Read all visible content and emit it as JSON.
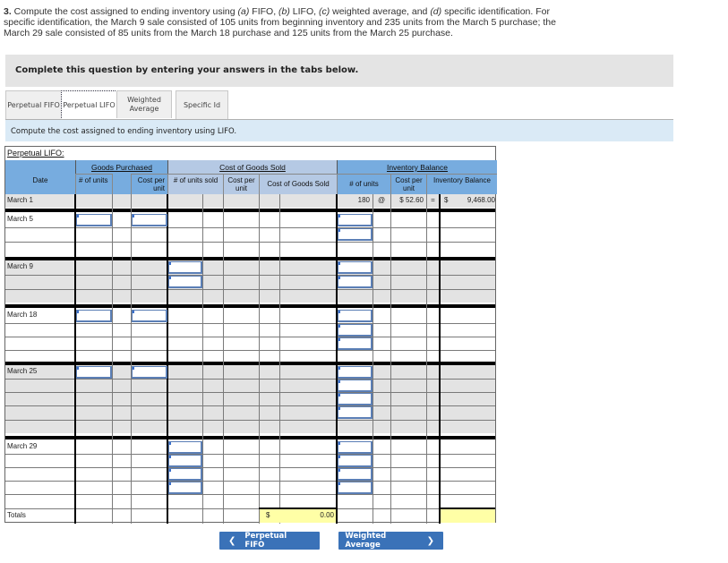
{
  "question": {
    "number": "3.",
    "line_parts": [
      " Compute the cost assigned to ending inventory using ",
      "(a)",
      " FIFO, ",
      "(b)",
      " LIFO, ",
      "(c)",
      " weighted average, and ",
      "(d)",
      " specific identification. For specific identification, the March 9 sale consisted of 105 units from beginning inventory and 235 units from the March 5 purchase; the March 29 sale consisted of 85 units from the March 18 purchase and 125 units from the March 25 purchase."
    ]
  },
  "instructions": "Complete this question by entering your answers in the tabs below.",
  "tabs": [
    {
      "label": "Perpetual FIFO",
      "active": false
    },
    {
      "label": "Perpetual LIFO",
      "active": true
    },
    {
      "label": "Weighted Average",
      "active": false
    },
    {
      "label": "Specific Id",
      "active": false
    }
  ],
  "prompt": "Compute the cost assigned to ending inventory using LIFO.",
  "table": {
    "title": "Perpetual LIFO:",
    "group_headers": {
      "goods_purchased": "Goods Purchased",
      "cost_of_goods_sold": "Cost of Goods Sold",
      "inventory_balance": "Inventory Balance"
    },
    "column_headers": {
      "date": "Date",
      "gp_units": "# of units",
      "gp_cost": "Cost per unit",
      "cgs_units": "# of units sold",
      "cgs_cost": "Cost per unit",
      "cgs_total": "Cost of Goods Sold",
      "ib_units": "# of units",
      "ib_cost": "Cost per unit",
      "ib_total": "Inventory Balance"
    },
    "beginning": {
      "date": "March 1",
      "units": "180",
      "at": "@",
      "cost": "$ 52.60",
      "eq": "=",
      "dollar": "$",
      "balance": "9,468.00"
    },
    "dates": [
      "March 5",
      "March 9",
      "March 18",
      "March 25",
      "March 29"
    ],
    "totals": {
      "label": "Totals",
      "cgs_dollar": "$",
      "cgs_total": "0.00",
      "ib_total": ""
    }
  },
  "nav": {
    "prev_label": "Perpetual FIFO",
    "next_label": "Weighted Average",
    "prev_icon": "chevron-left-icon",
    "next_icon": "chevron-right-icon"
  },
  "colors": {
    "header_blue": "#77acdf",
    "header_lavender": "#b5c9e4",
    "button_blue": "#3a72b8",
    "totals_yellow": "#ffffa6",
    "prompt_bg": "#daeaf6"
  }
}
